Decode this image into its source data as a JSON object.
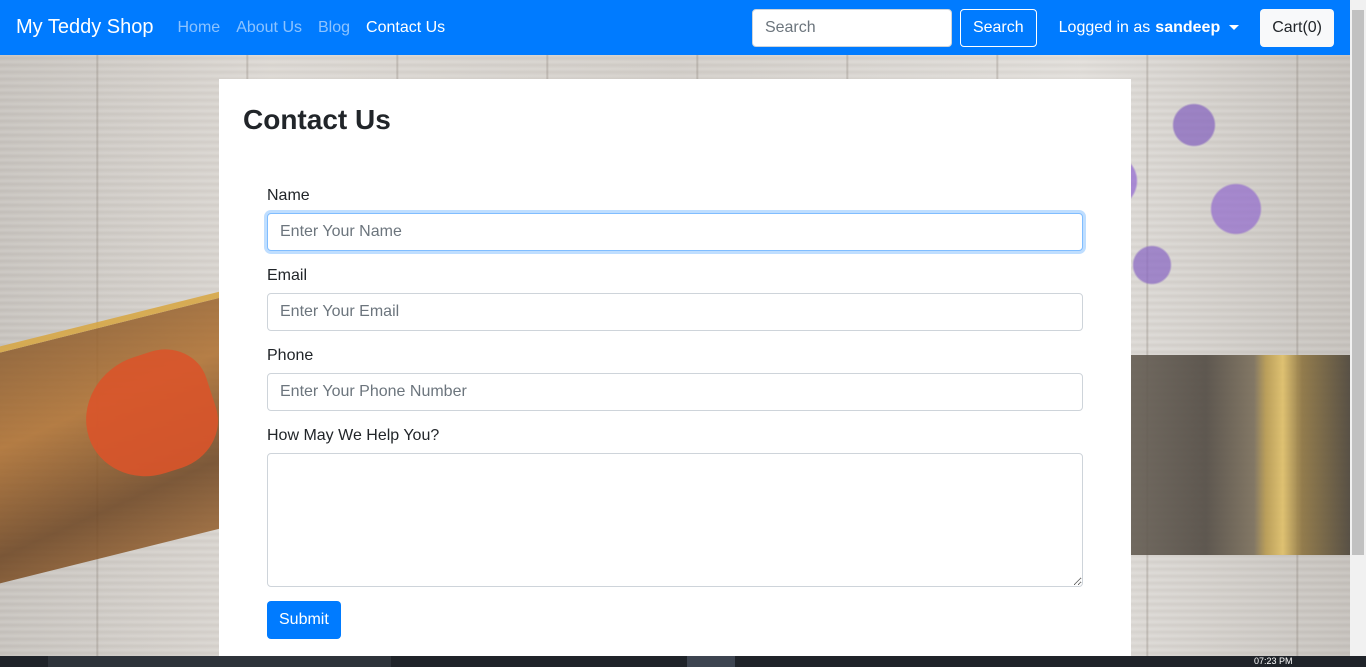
{
  "navbar": {
    "brand": "My Teddy Shop",
    "links": [
      {
        "label": "Home"
      },
      {
        "label": "About Us"
      },
      {
        "label": "Blog"
      },
      {
        "label": "Contact Us"
      }
    ],
    "search": {
      "placeholder": "Search",
      "button_label": "Search"
    },
    "user": {
      "prefix": "Logged in as",
      "username": "sandeep"
    },
    "cart_label": "Cart(0)",
    "accent_color": "#007bff"
  },
  "page": {
    "title": "Contact Us"
  },
  "form": {
    "name": {
      "label": "Name",
      "placeholder": "Enter Your Name"
    },
    "email": {
      "label": "Email",
      "placeholder": "Enter Your Email"
    },
    "phone": {
      "label": "Phone",
      "placeholder": "Enter Your Phone Number"
    },
    "message": {
      "label": "How May We Help You?"
    },
    "submit_label": "Submit"
  },
  "taskbar": {
    "clock": "07:23 PM"
  }
}
